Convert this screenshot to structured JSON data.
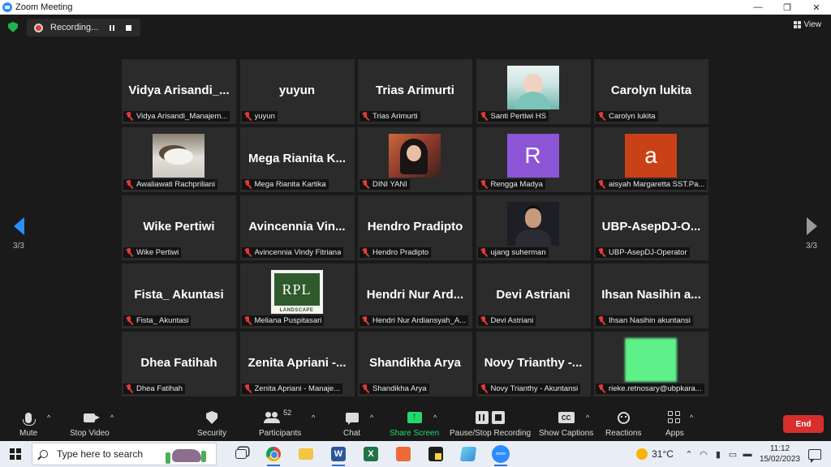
{
  "window": {
    "title": "Zoom Meeting",
    "controls": [
      "—",
      "❐",
      "✕"
    ]
  },
  "recording": {
    "label": "Recording..."
  },
  "view_button": {
    "label": "View"
  },
  "pager": {
    "left": "3/3",
    "right": "3/3"
  },
  "participants": [
    {
      "display": "Vidya  Arisandi_...",
      "name": "Vidya Arisandi_Manajem..."
    },
    {
      "display": "yuyun",
      "name": "yuyun"
    },
    {
      "display": "Trias Arimurti",
      "name": "Trias Arimurti"
    },
    {
      "picture": "santi",
      "name": "Santi Pertiwi HS"
    },
    {
      "display": "Carolyn lukita",
      "name": "Carolyn lukita"
    },
    {
      "picture": "cat",
      "name": "Awaliawati Rachpriliani"
    },
    {
      "display": "Mega  Rianita  K...",
      "name": "Mega Rianita Kartika"
    },
    {
      "picture": "dini",
      "name": "DINI YANI"
    },
    {
      "initial": "R",
      "initial_color": "#8c55d6",
      "name": "Rengga Madya"
    },
    {
      "initial": "a",
      "initial_color": "#c94116",
      "name": "aisyah Margaretta SST.Pa..."
    },
    {
      "display": "Wike Pertiwi",
      "name": "Wike Pertiwi"
    },
    {
      "display": "Avincennia  Vin...",
      "name": "Avincennia Vindy Fitriana"
    },
    {
      "display": "Hendro Pradipto",
      "name": "Hendro Pradipto"
    },
    {
      "picture": "ujang",
      "name": "ujang suherman"
    },
    {
      "display": "UBP-AsepDJ-O...",
      "name": "UBP-AsepDJ-Operator"
    },
    {
      "display": "Fista_ Akuntasi",
      "name": "Fista_ Akuntasi"
    },
    {
      "picture": "rpl",
      "logo_text": "RPL",
      "logo_sub": "LANDSCAPE",
      "name": "Meliana Puspitasari"
    },
    {
      "display": "Hendri  Nur  Ard...",
      "name": "Hendri Nur Ardiansyah_A..."
    },
    {
      "display": "Devi Astriani",
      "name": "Devi Astriani"
    },
    {
      "display": "Ihsan  Nasihin  a...",
      "name": "Ihsan Nasihin akuntansi"
    },
    {
      "display": "Dhea Fatihah",
      "name": "Dhea Fatihah"
    },
    {
      "display": "Zenita  Apriani  -...",
      "name": "Zenita Apriani - Manaje..."
    },
    {
      "display": "Shandikha Arya",
      "name": "Shandikha Arya"
    },
    {
      "display": "Novy  Trianthy  -...",
      "name": "Novy Trianthy - Akuntansi"
    },
    {
      "picture": "green",
      "name": "rieke.retnosary@ubpkara..."
    }
  ],
  "toolbar": {
    "mute": "Mute",
    "stop_video": "Stop Video",
    "security": "Security",
    "participants": "Participants",
    "participants_count": "52",
    "chat": "Chat",
    "share_screen": "Share Screen",
    "pause_stop_recording": "Pause/Stop Recording",
    "show_captions": "Show Captions",
    "cc": "CC",
    "reactions": "Reactions",
    "apps": "Apps",
    "end": "End",
    "share_color": "#23d96c",
    "end_color": "#d82e2e"
  },
  "taskbar": {
    "search_placeholder": "Type here to search",
    "weather": "31°C",
    "time": "11:12",
    "date": "15/02/2023",
    "apps": [
      "task-view",
      "chrome",
      "file-explorer",
      "word",
      "excel",
      "orange-app",
      "sticky-notes",
      "store",
      "zoom"
    ],
    "word_letter": "W",
    "excel_letter": "X",
    "zoom_label": "zoom"
  }
}
